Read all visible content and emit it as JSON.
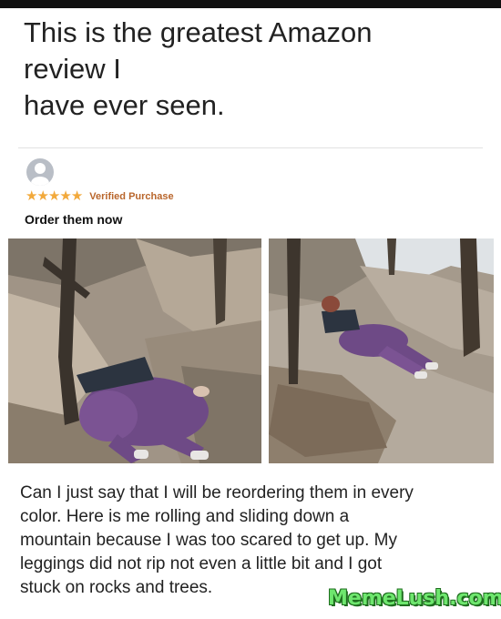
{
  "headline": {
    "lines": [
      "This is the greatest Amazon",
      "review I",
      "have ever seen."
    ]
  },
  "review": {
    "stars": 5,
    "badge": "Verified Purchase",
    "title": "Order them now",
    "body_lines": [
      "Can I just say that I will be reordering them in every",
      "color. Here is me rolling and sliding down a",
      "mountain because I was too scared to get up. My",
      "leggings did not rip not even a little bit and I got",
      "stuck on rocks and trees."
    ]
  },
  "watermark": "MemeLush.com",
  "colors": {
    "star": "#f2a93b",
    "badge": "#b9662c",
    "leggings": "#6e4a86",
    "rock": "#9c8f80"
  }
}
